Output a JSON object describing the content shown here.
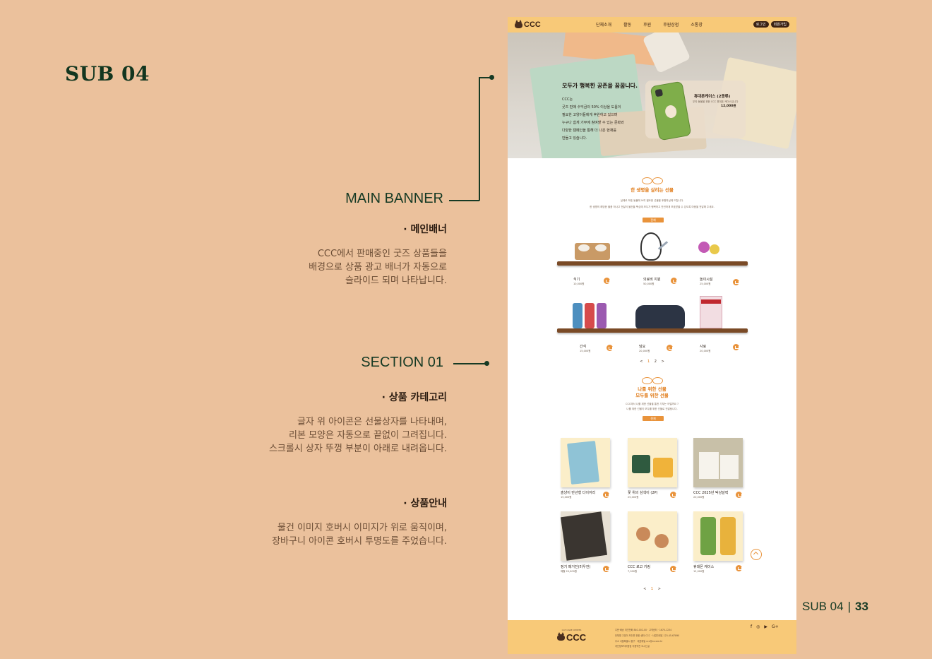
{
  "slide": {
    "title": "SUB 04",
    "page_label": "SUB 04",
    "page_sep": "|",
    "page_number": "33"
  },
  "annotations": {
    "main_banner": {
      "heading": "MAIN BANNER",
      "sub": "· 메인배너",
      "desc": "CCC에서 판매중인 굿즈 상품들을\n배경으로 상품 광고 배너가 자동으로\n슬라이드 되며 나타납니다."
    },
    "section01": {
      "heading": "SECTION 01",
      "sub1": "· 상품 카테고리",
      "desc1": "글자 위 아이콘은 선물상자를 나타내며,\n리본 모양은 자동으로 끝없이 그려집니다.\n스크롤시 상자 뚜껑 부분이 아래로 내려옵니다.",
      "sub2": "· 상품안내",
      "desc2": "물건 이미지 호버시 이미지가 위로 움직이며,\n장바구니 아이콘 호버시 투명도를 주었습니다."
    }
  },
  "site": {
    "header": {
      "logo": "CCC",
      "nav": [
        "단체소개",
        "활동",
        "후원",
        "후원상점",
        "소통창"
      ],
      "login": "로그인",
      "signup": "회원가입"
    },
    "banner": {
      "headline": "모두가 행복한 공존을 꿈꿉니다.",
      "copy": "CCC는\n굿즈 판매 수익금의 50% 이상을 도움이\n필요한 고양이들에게 후원하고 있으며\n누구나 쉽게 기부에 참여할 수 있는 문화와\n다양한 캠페인을 통해 더 나은 현재를\n만들고 있습니다.",
      "product_name": "휴대폰케이스 (2종류)",
      "product_desc": "우리 동물을 위한 CCC 휴대폰 케이스입니다",
      "product_price": "12,000원"
    },
    "section1": {
      "title": "한 생명을 살리는 선물",
      "sub1": "실제로 보호 동물에 쓰여 필요한 선물을 후원하실께 드립니다.",
      "sub2": "한 생명의 해당한 물품 하나고 전달이 물건을 핵심에 모두가 행복하고 안전하게 보호받을 수 있도록 마음을 전달해 주세요.",
      "select": "전체",
      "items": [
        {
          "name": "식기",
          "price": "10,000원"
        },
        {
          "name": "의료비 지원",
          "price": "50,000원"
        },
        {
          "name": "놀이시설",
          "price": "25,000원"
        },
        {
          "name": "간식",
          "price": "15,000원"
        },
        {
          "name": "담요",
          "price": "20,000원"
        },
        {
          "name": "사료",
          "price": "20,000원"
        }
      ],
      "pager": {
        "prev": "<",
        "p1": "1",
        "p2": "2",
        "next": ">"
      }
    },
    "section2": {
      "title_line1": "나를 위한 선물",
      "title_line2": "모두를 위한 선물",
      "sub1": "CCC에서 나를 위한 선물을 통한 기부는 어떨까요 ?",
      "sub2": "나를 위한 선물이 모두를 위한 선물로 전달됩니다.",
      "select": "전체",
      "items": [
        {
          "name": "솔냥이 만년형 다이어리",
          "price": "15,000원"
        },
        {
          "name": "꽃 위의 삼색이 (2P)",
          "price": "25,000원"
        },
        {
          "name": "CCC 2025년 탁상달력",
          "price": "20,000원"
        },
        {
          "name": "정기 매거진(미우전)",
          "price": "매월 20,000원"
        },
        {
          "name": "CCC 로고 키링",
          "price": "7,000원"
        },
        {
          "name": "휴대폰 케이스",
          "price": "12,000원"
        }
      ],
      "pager": {
        "prev": "<",
        "p1": "1",
        "next": ">"
      }
    },
    "footer": {
      "logo_small": "CAT CARE CENTER",
      "logo": "CCC",
      "info": "주문·배송 개인전화 840-002-00 · 고객센터 · 1670-1234\n단체명 고양이 모두를 위한 센터 CCC · 사업자번호 123-45-67890\n주소 서울특별시 중구 · 대표메일 ccc@cccare.kr",
      "links": "개인정보처리방침    이용약관    오시는길",
      "social": [
        "f",
        "◎",
        "▶",
        "G+"
      ]
    }
  }
}
